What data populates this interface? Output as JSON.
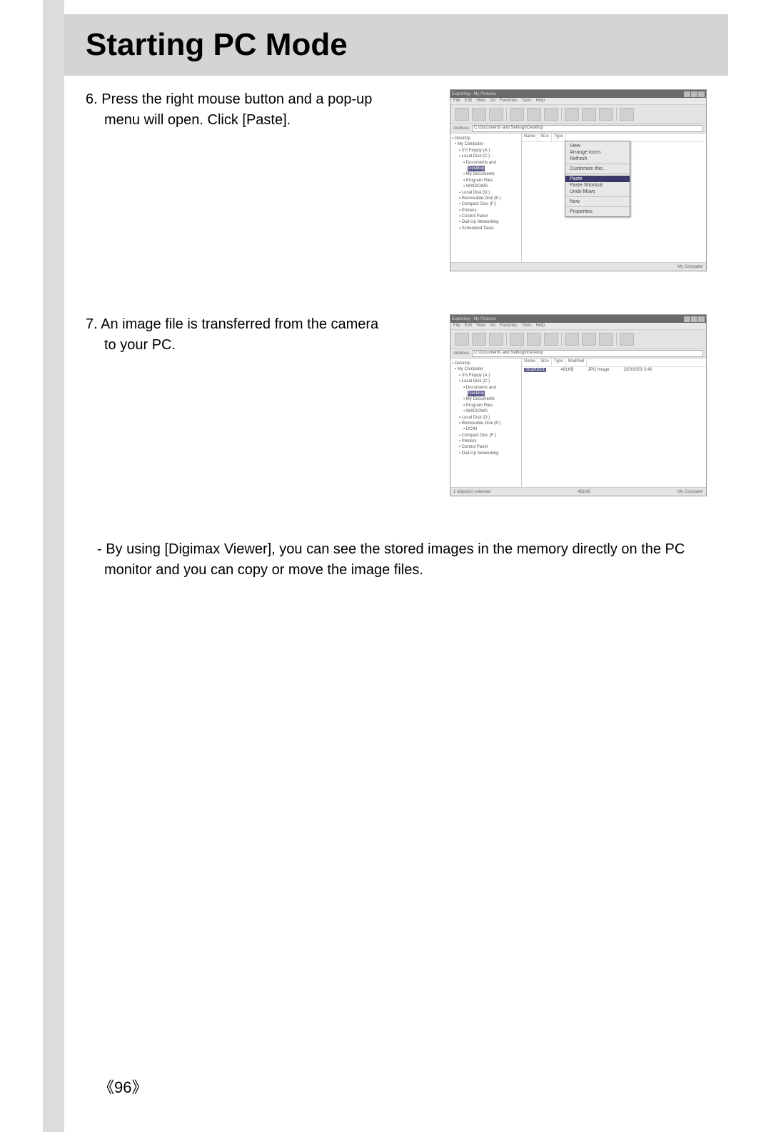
{
  "title": "Starting PC Mode",
  "steps": [
    {
      "num": "6.",
      "text": "Press the right mouse button and a pop-up menu will open. Click [Paste]."
    },
    {
      "num": "7.",
      "text": "An image file is transferred from the camera to your PC."
    }
  ],
  "note": "- By using [Digimax Viewer], you can see the stored images in the memory directly on the PC monitor and you can copy or move the image files.",
  "pageNumber": "96",
  "screenshot1": {
    "menubar": [
      "File",
      "Edit",
      "View",
      "Go",
      "Favorites",
      "Tools",
      "Help"
    ],
    "columns": [
      "Name",
      "Size",
      "Type"
    ],
    "addressLabel": "Address",
    "address": "C:\\Documents and Settings\\Desktop",
    "tree": [
      {
        "t": "Desktop",
        "lv": 0
      },
      {
        "t": "My Computer",
        "lv": 1
      },
      {
        "t": "3½ Floppy (A:)",
        "lv": 2
      },
      {
        "t": "Local Disk (C:)",
        "lv": 2
      },
      {
        "t": "Documents and",
        "lv": 3
      },
      {
        "t": "Desktop",
        "lv": 4,
        "sel": true
      },
      {
        "t": "My Documents",
        "lv": 3
      },
      {
        "t": "Program Files",
        "lv": 3
      },
      {
        "t": "WINDOWS",
        "lv": 3
      },
      {
        "t": "Local Disk (D:)",
        "lv": 2
      },
      {
        "t": "Removable Disk (E:)",
        "lv": 2
      },
      {
        "t": "Compact Disc (F:)",
        "lv": 2
      },
      {
        "t": "Printers",
        "lv": 2
      },
      {
        "t": "Control Panel",
        "lv": 2
      },
      {
        "t": "Dial-Up Networking",
        "lv": 2
      },
      {
        "t": "Scheduled Tasks",
        "lv": 2
      }
    ],
    "contextMenu": {
      "groups": [
        [
          "View",
          "Arrange Icons",
          "Refresh"
        ],
        [
          "Customize this..."
        ],
        [
          "Paste",
          "Paste Shortcut",
          "Undo Move"
        ],
        [
          "New"
        ],
        [
          "Properties"
        ]
      ],
      "highlighted": "Paste"
    },
    "status": "My Computer"
  },
  "screenshot2": {
    "menubar": [
      "File",
      "Edit",
      "View",
      "Go",
      "Favorites",
      "Tools",
      "Help"
    ],
    "columns": [
      "Name",
      "Size",
      "Type",
      "Modified"
    ],
    "addressLabel": "Address",
    "address": "C:\\Documents and Settings\\Desktop",
    "tree": [
      {
        "t": "Desktop",
        "lv": 0
      },
      {
        "t": "My Computer",
        "lv": 1
      },
      {
        "t": "3½ Floppy (A:)",
        "lv": 2
      },
      {
        "t": "Local Disk (C:)",
        "lv": 2
      },
      {
        "t": "Documents and",
        "lv": 3
      },
      {
        "t": "Desktop",
        "lv": 4,
        "sel": true
      },
      {
        "t": "My Documents",
        "lv": 3
      },
      {
        "t": "Program Files",
        "lv": 3
      },
      {
        "t": "WINDOWS",
        "lv": 3
      },
      {
        "t": "Local Disk (D:)",
        "lv": 2
      },
      {
        "t": "Removable Disk (E:)",
        "lv": 2
      },
      {
        "t": "DCIM",
        "lv": 3
      },
      {
        "t": "Compact Disc (F:)",
        "lv": 2
      },
      {
        "t": "Printers",
        "lv": 2
      },
      {
        "t": "Control Panel",
        "lv": 2
      },
      {
        "t": "Dial-Up Networking",
        "lv": 2
      }
    ],
    "file": {
      "name": "S5300001",
      "size": "481KB",
      "type": "JPG Image",
      "date": "2/20/2003 3:40"
    },
    "statusLeft": "1 object(s) selected",
    "statusMid": "481KB",
    "statusRight": "My Computer"
  }
}
